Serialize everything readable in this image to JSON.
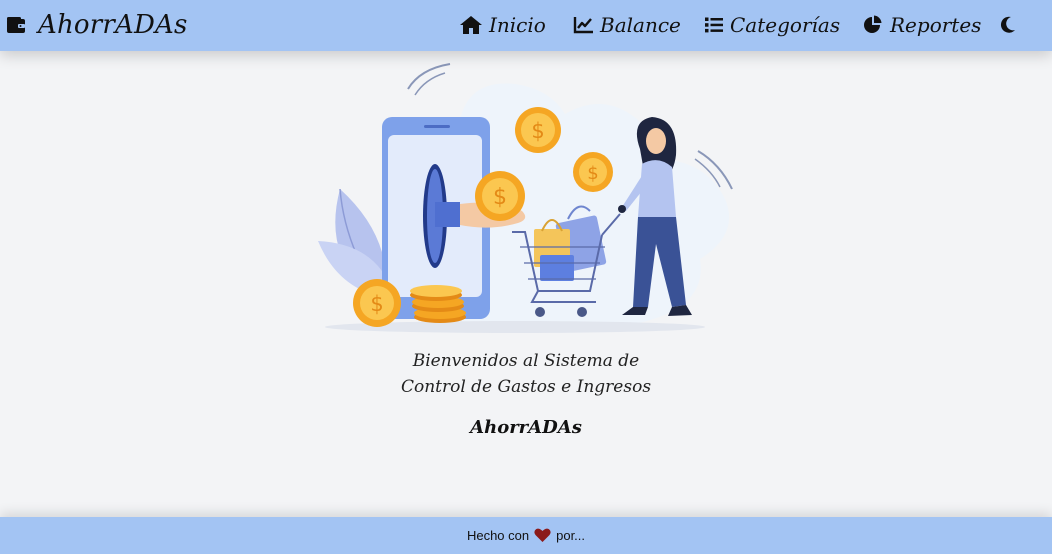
{
  "brand": {
    "name": "AhorrADAs",
    "icon": "wallet-icon"
  },
  "nav": {
    "items": [
      {
        "label": "Inicio",
        "icon": "home-icon"
      },
      {
        "label": "Balance",
        "icon": "chart-line-icon"
      },
      {
        "label": "Categorías",
        "icon": "list-icon"
      },
      {
        "label": "Reportes",
        "icon": "pie-chart-icon"
      }
    ],
    "theme_toggle_icon": "moon-icon"
  },
  "main": {
    "welcome_line1": "Bienvenidos al Sistema de",
    "welcome_line2": "Control de Gastos e Ingresos",
    "app_name": "AhorrADAs"
  },
  "footer": {
    "text_before": "Hecho con",
    "text_after": "por...",
    "heart_icon": "heart-icon"
  },
  "colors": {
    "nav_bg": "#a3c4f3",
    "page_bg": "#f3f4f6",
    "heart": "#8b1a1a",
    "coin": "#f5a623"
  }
}
